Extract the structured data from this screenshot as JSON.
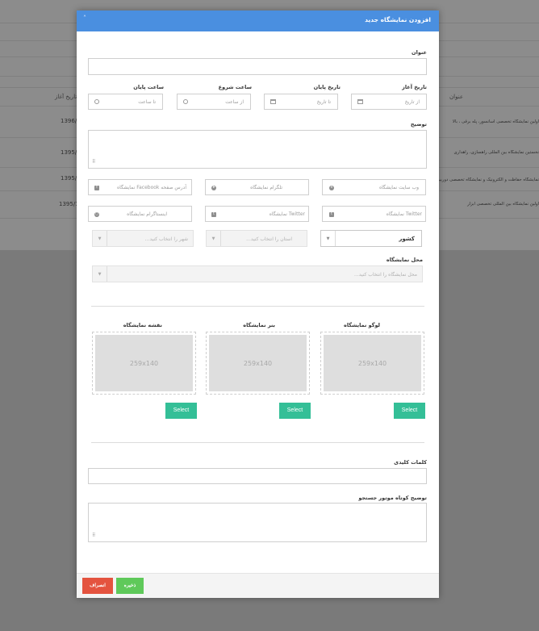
{
  "background": {
    "table": {
      "col_title": "عنوان",
      "col_start_date": "تاریخ آغاز",
      "rows": [
        {
          "title": "اولین نمایشگاه تخصصی آسانسور، پله برقی ، بالا",
          "date": "1396/"
        },
        {
          "title": "نخستین نمایشگاه بین المللی راهسازی، راهداری",
          "date": "1395/"
        },
        {
          "title": "نمایشگاه حفاظت و الکترونیک و نمایشگاه تخصصی دوربین ها",
          "date": "1395/"
        },
        {
          "title": "اولین نمایشگاه بین المللی تخصصی ابزار",
          "date": "1395/1"
        }
      ]
    }
  },
  "modal": {
    "title": "افزودن نمایشگاه جدید",
    "close_icon": "˄",
    "fields": {
      "title_label": "عنوان",
      "start_date_label": "تاریخ آغاز",
      "start_date_placeholder": "از تاریخ",
      "end_date_label": "تاریخ پایان",
      "end_date_placeholder": "تا تاریخ",
      "start_time_label": "ساعت شروع",
      "start_time_placeholder": "از ساعت",
      "end_time_label": "ساعت پایان",
      "end_time_placeholder": "تا ساعت",
      "description_label": "توضیح",
      "website_placeholder": "وب سایت نمایشگاه",
      "telegram_placeholder": "تلگرام نمایشگاه",
      "facebook_placeholder": "آدرس صفحه Facebook نمایشگاه",
      "twitter1_placeholder": "Twitter نمایشگاه",
      "twitter2_placeholder": "Twitter نمایشگاه",
      "instagram_placeholder": "اینستاگرام نمایشگاه",
      "country_value": "کشور",
      "province_placeholder": "استان را انتخاب کنید...",
      "city_placeholder": "شهر را انتخاب کنید...",
      "venue_label": "محل نمایشگاه",
      "venue_placeholder": "محل نمایشگاه را انتخاب کنید...",
      "logo_label": "لوگو نمایشگاه",
      "banner_label": "بنر نمایشگاه",
      "map_label": "نقشه نمایشگاه",
      "image_placeholder": "259x140",
      "select_button": "Select",
      "keywords_label": "کلمات کلیدی",
      "seo_description_label": "توضیح کوتاه موتور جستجو"
    },
    "footer": {
      "save_label": "ذخیره",
      "cancel_label": "انصراف"
    }
  }
}
